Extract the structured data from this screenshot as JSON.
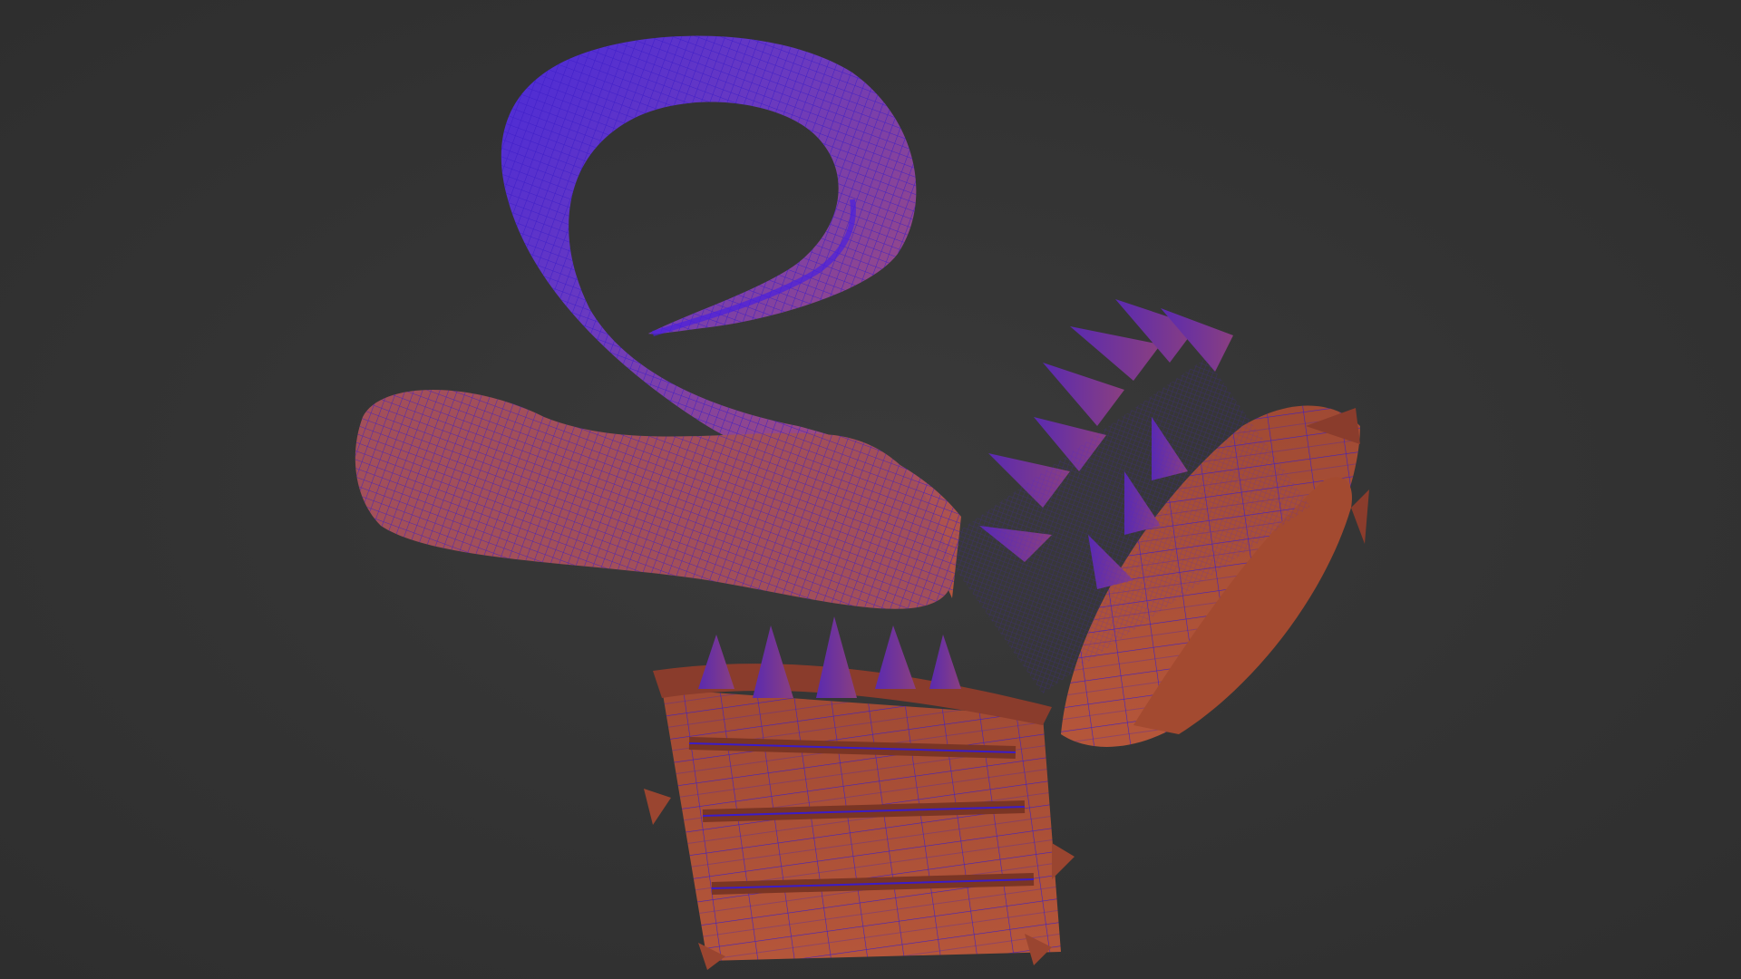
{
  "viewport": {
    "background": "#333333",
    "shading": "wireframe-on-shaded"
  },
  "model": {
    "subject": "mimic-chest-with-tongue",
    "colors": {
      "surface": "#b5563a",
      "surface_dark": "#7a3524",
      "wireframe": "#3b1cc8",
      "wireframe_dense": "#4a20e0"
    }
  }
}
